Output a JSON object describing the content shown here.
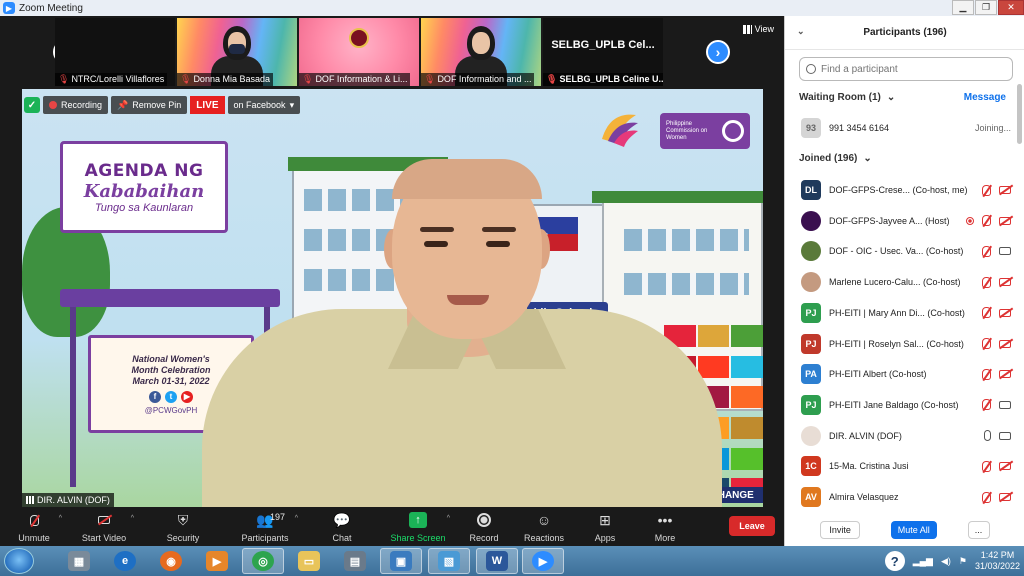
{
  "window": {
    "title": "Zoom Meeting"
  },
  "thumbnails": [
    {
      "name": "NTRC/Lorelli Villaflores",
      "style": "dark"
    },
    {
      "name": "Donna Mia Basada",
      "style": "rainbow-person"
    },
    {
      "name": "DOF Information & Li...",
      "style": "pink-seal"
    },
    {
      "name": "DOF Information and ...",
      "style": "rainbow-person"
    },
    {
      "name": "SELBG_UPLB Celine U...",
      "tile_text": "SELBG_UPLB  Cel...",
      "style": "text"
    }
  ],
  "view_label": "View",
  "overlays": {
    "recording": "Recording",
    "remove_pin": "Remove Pin",
    "live": "LIVE",
    "live_target": "on Facebook"
  },
  "scene": {
    "agenda_line1": "AGENDA NG",
    "agenda_line2": "Kababaihan",
    "agenda_line3": "Tungo sa Kaunlaran",
    "event_line1": "National Women's",
    "event_line2": "Month Celebration",
    "event_line3": "March 01-31, 2022",
    "hashtag": "@PCWGovPH",
    "school_sign": "Public School",
    "pcw_text": "Philippine Commission on Women",
    "exchange": "EXCHANGE"
  },
  "main_speaker": "DIR. ALVIN (DOF)",
  "toolbar": {
    "unmute": "Unmute",
    "start_video": "Start Video",
    "security": "Security",
    "participants": "Participants",
    "participants_count": "197",
    "chat": "Chat",
    "share_screen": "Share Screen",
    "record": "Record",
    "reactions": "Reactions",
    "apps": "Apps",
    "more": "More",
    "leave": "Leave"
  },
  "panel": {
    "title": "Participants (196)",
    "search_placeholder": "Find a participant",
    "waiting_room": "Waiting Room (1)",
    "message": "Message",
    "waiting": [
      {
        "avatar": "93",
        "name": "991 3454 6164",
        "status": "Joining..."
      }
    ],
    "joined_header": "Joined (196)",
    "joined": [
      {
        "initials": "DL",
        "color": "#1f3a5c",
        "name": "DOF-GFPS-Crese... (Co-host, me)",
        "icons": [
          "mute",
          "vidoff"
        ]
      },
      {
        "initials": "",
        "color": "#3a0f4f",
        "name": "DOF-GFPS-Jayvee A... (Host)",
        "icons": [
          "rec",
          "mute",
          "vidoff"
        ]
      },
      {
        "initials": "",
        "color": "#5a7a3a",
        "name": "DOF - OIC - Usec. Va... (Co-host)",
        "icons": [
          "mute",
          "vid"
        ]
      },
      {
        "initials": "",
        "color": "#c49a80",
        "name": "Marlene Lucero-Calu... (Co-host)",
        "icons": [
          "mute",
          "vidoff"
        ]
      },
      {
        "initials": "PJ",
        "color": "#2e9e4f",
        "name": "PH-EITI | Mary Ann Di... (Co-host)",
        "icons": [
          "mute",
          "vidoff"
        ]
      },
      {
        "initials": "PJ",
        "color": "#c0392b",
        "name": "PH-EITI | Roselyn Sal... (Co-host)",
        "icons": [
          "mute",
          "vidoff"
        ]
      },
      {
        "initials": "PA",
        "color": "#2d7fd1",
        "name": "PH-EITI Albert (Co-host)",
        "icons": [
          "mute",
          "vidoff"
        ]
      },
      {
        "initials": "PJ",
        "color": "#2e9e4f",
        "name": "PH-EITI Jane Baldago (Co-host)",
        "icons": [
          "mute",
          "vid"
        ]
      },
      {
        "initials": "",
        "color": "#e8ddd5",
        "name": "DIR. ALVIN (DOF)",
        "icons": [
          "mic",
          "vid"
        ]
      },
      {
        "initials": "1C",
        "color": "#d0381f",
        "name": "15-Ma. Cristina Jusi",
        "icons": [
          "mute",
          "vidoff"
        ]
      },
      {
        "initials": "AV",
        "color": "#e0781f",
        "name": "Almira Velasquez",
        "icons": [
          "mute",
          "vidoff"
        ]
      }
    ],
    "invite": "Invite",
    "mute_all": "Mute All",
    "more": "..."
  },
  "taskbar": {
    "time": "1:42 PM",
    "date": "31/03/2022"
  }
}
